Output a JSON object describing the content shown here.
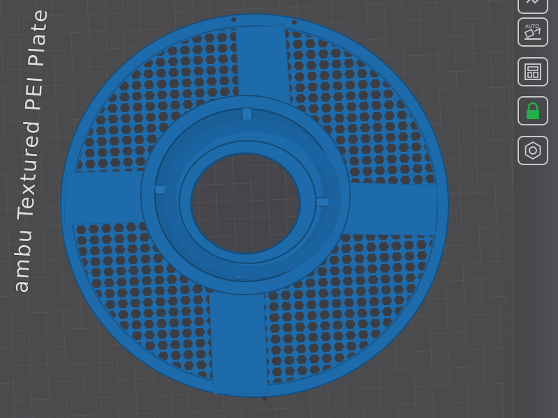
{
  "viewport": {
    "plate_label": "ambu Textured PEI Plate",
    "model_color": "#1e6bab",
    "bed_color": "#4a4a4d",
    "grid_color": "#5a5a5e"
  },
  "toolbar": {
    "buttons": [
      {
        "icon": "arrange-icon"
      },
      {
        "icon": "auto-orient-icon",
        "badge": "AUTO"
      },
      {
        "icon": "plate-layout-icon"
      },
      {
        "icon": "lock-icon",
        "accent": "#22b04a"
      },
      {
        "icon": "nut-settings-icon"
      }
    ]
  }
}
